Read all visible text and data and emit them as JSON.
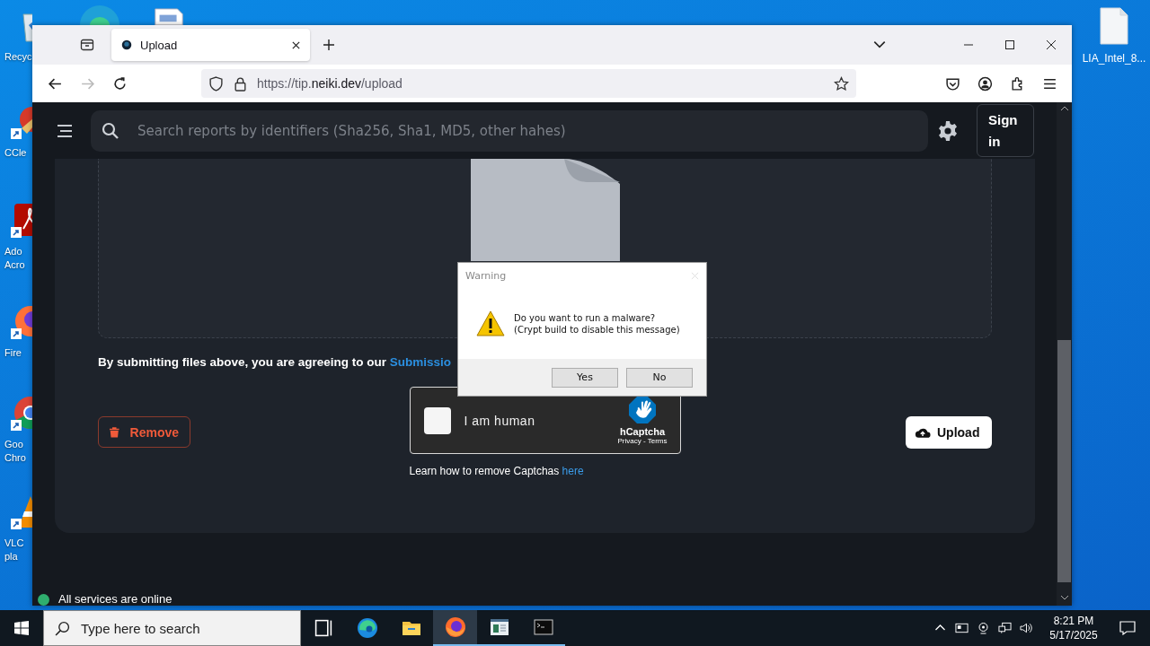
{
  "desktop_icons": [
    {
      "kind": "recycle",
      "lines": [
        "Recyc"
      ]
    },
    {
      "kind": "ccleaner",
      "lines": [
        "CCle"
      ]
    },
    {
      "kind": "acrobat",
      "lines": [
        "Ado",
        "Acro"
      ]
    },
    {
      "kind": "firefox",
      "lines": [
        "Fire"
      ]
    },
    {
      "kind": "chrome",
      "lines": [
        "Goo",
        "Chro"
      ]
    },
    {
      "kind": "vlc",
      "lines": [
        "VLC",
        "pla"
      ]
    }
  ],
  "desktop_file": {
    "label": "LIA_Intel_8..."
  },
  "browser": {
    "tab": {
      "title": "Upload",
      "selected": true
    },
    "nav": {
      "back_disabled": false,
      "forward_disabled": true
    },
    "url": "https://tip.**neiki.dev**/upload"
  },
  "page": {
    "search": {
      "placeholder": "Search reports by identifiers (Sha256, Sha1, MD5, other hahes)"
    },
    "sign_in": "Sign in",
    "agreement": {
      "text": "By submitting files above, you are agreeing to our",
      "link": "Submissio"
    },
    "remove": "Remove",
    "upload": "Upload",
    "captcha": {
      "checked": false,
      "label": "I am human",
      "brand": "hCaptcha",
      "links": "Privacy - Terms"
    },
    "captcha_help": {
      "text": "Learn how to remove Captchas",
      "link": "here"
    },
    "status": "All services are online"
  },
  "dialog": {
    "title": "Warning",
    "lines": [
      "Do you want to run a malware?",
      "(Crypt build to disable this message)"
    ],
    "buttons": [
      "Yes",
      "No"
    ]
  },
  "taskbar": {
    "search_placeholder": "Type here to search",
    "apps": [
      {
        "kind": "taskview",
        "selected": false,
        "running": false
      },
      {
        "kind": "edge",
        "selected": false,
        "running": false
      },
      {
        "kind": "explorer",
        "selected": false,
        "running": false
      },
      {
        "kind": "firefox",
        "selected": true,
        "running": true
      },
      {
        "kind": "window",
        "selected": false,
        "running": true
      },
      {
        "kind": "terminal",
        "selected": false,
        "running": true
      }
    ],
    "time": "8:21 PM",
    "date": "5/17/2025"
  }
}
